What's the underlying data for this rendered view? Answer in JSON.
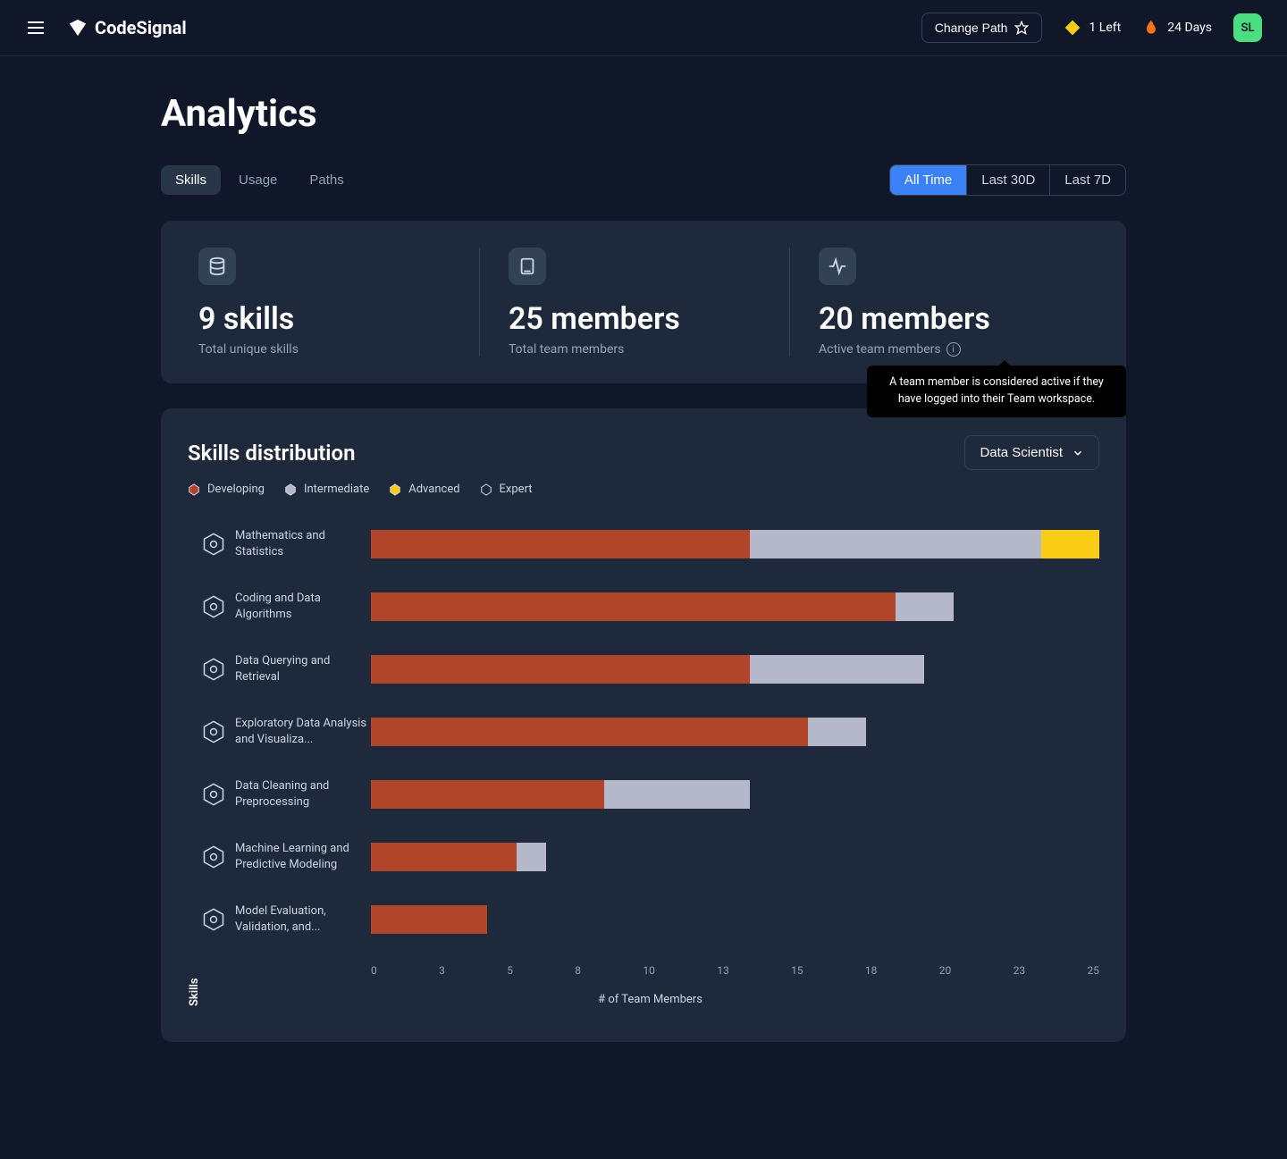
{
  "header": {
    "brand": "CodeSignal",
    "change_path": "Change Path",
    "left_pill": "1 Left",
    "days_pill": "24 Days",
    "avatar": "SL"
  },
  "page_title": "Analytics",
  "tabs": [
    "Skills",
    "Usage",
    "Paths"
  ],
  "active_tab": 0,
  "range_tabs": [
    "All Time",
    "Last 30D",
    "Last 7D"
  ],
  "active_range": 0,
  "stats": [
    {
      "value": "9 skills",
      "label": "Total unique skills",
      "icon": "database"
    },
    {
      "value": "25 members",
      "label": "Total team members",
      "icon": "book"
    },
    {
      "value": "20 members",
      "label": "Active team members",
      "icon": "activity",
      "info": true
    }
  ],
  "tooltip_text": "A team member is considered active if they have logged into their Team workspace.",
  "chart": {
    "title": "Skills distribution",
    "dropdown": "Data Scientist",
    "legend": [
      "Developing",
      "Intermediate",
      "Advanced",
      "Expert"
    ],
    "legend_colors": [
      "#b0452a",
      "#b5b8c9",
      "#facc15",
      "transparent"
    ],
    "ylabel": "Skills",
    "xlabel": "# of Team Members"
  },
  "chart_data": {
    "type": "bar",
    "orientation": "horizontal",
    "xlabel": "# of Team Members",
    "ylabel": "Skills",
    "xlim": [
      0,
      25
    ],
    "xticks": [
      0,
      3,
      5,
      8,
      10,
      13,
      15,
      18,
      20,
      23,
      25
    ],
    "categories": [
      "Mathematics and Statistics",
      "Coding and Data Algorithms",
      "Data Querying and Retrieval",
      "Exploratory Data Analysis and Visualiza...",
      "Data Cleaning and Preprocessing",
      "Machine Learning and Predictive Modeling",
      "Model Evaluation, Validation, and..."
    ],
    "series": [
      {
        "name": "Developing",
        "color": "#b0452a",
        "values": [
          13,
          18,
          13,
          15,
          8,
          5,
          4
        ]
      },
      {
        "name": "Intermediate",
        "color": "#b5b8c9",
        "values": [
          10,
          2,
          6,
          2,
          5,
          1,
          0
        ]
      },
      {
        "name": "Advanced",
        "color": "#facc15",
        "values": [
          2,
          0,
          0,
          0,
          0,
          0,
          0
        ]
      },
      {
        "name": "Expert",
        "color": "transparent",
        "values": [
          0,
          0,
          0,
          0,
          0,
          0,
          0
        ]
      }
    ]
  }
}
